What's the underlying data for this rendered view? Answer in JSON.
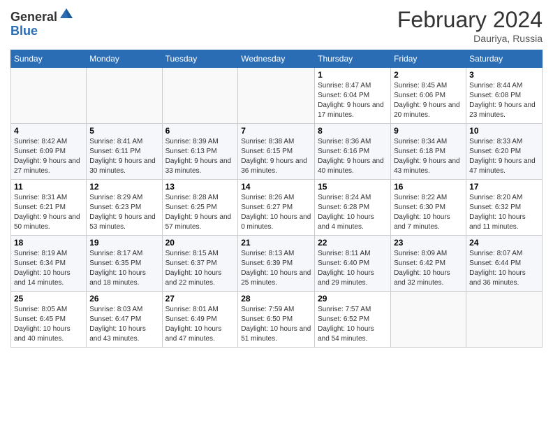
{
  "header": {
    "logo_line1": "General",
    "logo_line2": "Blue",
    "month_year": "February 2024",
    "location": "Dauriya, Russia"
  },
  "days_of_week": [
    "Sunday",
    "Monday",
    "Tuesday",
    "Wednesday",
    "Thursday",
    "Friday",
    "Saturday"
  ],
  "weeks": [
    [
      {
        "day": "",
        "info": ""
      },
      {
        "day": "",
        "info": ""
      },
      {
        "day": "",
        "info": ""
      },
      {
        "day": "",
        "info": ""
      },
      {
        "day": "1",
        "info": "Sunrise: 8:47 AM\nSunset: 6:04 PM\nDaylight: 9 hours and 17 minutes."
      },
      {
        "day": "2",
        "info": "Sunrise: 8:45 AM\nSunset: 6:06 PM\nDaylight: 9 hours and 20 minutes."
      },
      {
        "day": "3",
        "info": "Sunrise: 8:44 AM\nSunset: 6:08 PM\nDaylight: 9 hours and 23 minutes."
      }
    ],
    [
      {
        "day": "4",
        "info": "Sunrise: 8:42 AM\nSunset: 6:09 PM\nDaylight: 9 hours and 27 minutes."
      },
      {
        "day": "5",
        "info": "Sunrise: 8:41 AM\nSunset: 6:11 PM\nDaylight: 9 hours and 30 minutes."
      },
      {
        "day": "6",
        "info": "Sunrise: 8:39 AM\nSunset: 6:13 PM\nDaylight: 9 hours and 33 minutes."
      },
      {
        "day": "7",
        "info": "Sunrise: 8:38 AM\nSunset: 6:15 PM\nDaylight: 9 hours and 36 minutes."
      },
      {
        "day": "8",
        "info": "Sunrise: 8:36 AM\nSunset: 6:16 PM\nDaylight: 9 hours and 40 minutes."
      },
      {
        "day": "9",
        "info": "Sunrise: 8:34 AM\nSunset: 6:18 PM\nDaylight: 9 hours and 43 minutes."
      },
      {
        "day": "10",
        "info": "Sunrise: 8:33 AM\nSunset: 6:20 PM\nDaylight: 9 hours and 47 minutes."
      }
    ],
    [
      {
        "day": "11",
        "info": "Sunrise: 8:31 AM\nSunset: 6:21 PM\nDaylight: 9 hours and 50 minutes."
      },
      {
        "day": "12",
        "info": "Sunrise: 8:29 AM\nSunset: 6:23 PM\nDaylight: 9 hours and 53 minutes."
      },
      {
        "day": "13",
        "info": "Sunrise: 8:28 AM\nSunset: 6:25 PM\nDaylight: 9 hours and 57 minutes."
      },
      {
        "day": "14",
        "info": "Sunrise: 8:26 AM\nSunset: 6:27 PM\nDaylight: 10 hours and 0 minutes."
      },
      {
        "day": "15",
        "info": "Sunrise: 8:24 AM\nSunset: 6:28 PM\nDaylight: 10 hours and 4 minutes."
      },
      {
        "day": "16",
        "info": "Sunrise: 8:22 AM\nSunset: 6:30 PM\nDaylight: 10 hours and 7 minutes."
      },
      {
        "day": "17",
        "info": "Sunrise: 8:20 AM\nSunset: 6:32 PM\nDaylight: 10 hours and 11 minutes."
      }
    ],
    [
      {
        "day": "18",
        "info": "Sunrise: 8:19 AM\nSunset: 6:34 PM\nDaylight: 10 hours and 14 minutes."
      },
      {
        "day": "19",
        "info": "Sunrise: 8:17 AM\nSunset: 6:35 PM\nDaylight: 10 hours and 18 minutes."
      },
      {
        "day": "20",
        "info": "Sunrise: 8:15 AM\nSunset: 6:37 PM\nDaylight: 10 hours and 22 minutes."
      },
      {
        "day": "21",
        "info": "Sunrise: 8:13 AM\nSunset: 6:39 PM\nDaylight: 10 hours and 25 minutes."
      },
      {
        "day": "22",
        "info": "Sunrise: 8:11 AM\nSunset: 6:40 PM\nDaylight: 10 hours and 29 minutes."
      },
      {
        "day": "23",
        "info": "Sunrise: 8:09 AM\nSunset: 6:42 PM\nDaylight: 10 hours and 32 minutes."
      },
      {
        "day": "24",
        "info": "Sunrise: 8:07 AM\nSunset: 6:44 PM\nDaylight: 10 hours and 36 minutes."
      }
    ],
    [
      {
        "day": "25",
        "info": "Sunrise: 8:05 AM\nSunset: 6:45 PM\nDaylight: 10 hours and 40 minutes."
      },
      {
        "day": "26",
        "info": "Sunrise: 8:03 AM\nSunset: 6:47 PM\nDaylight: 10 hours and 43 minutes."
      },
      {
        "day": "27",
        "info": "Sunrise: 8:01 AM\nSunset: 6:49 PM\nDaylight: 10 hours and 47 minutes."
      },
      {
        "day": "28",
        "info": "Sunrise: 7:59 AM\nSunset: 6:50 PM\nDaylight: 10 hours and 51 minutes."
      },
      {
        "day": "29",
        "info": "Sunrise: 7:57 AM\nSunset: 6:52 PM\nDaylight: 10 hours and 54 minutes."
      },
      {
        "day": "",
        "info": ""
      },
      {
        "day": "",
        "info": ""
      }
    ]
  ]
}
